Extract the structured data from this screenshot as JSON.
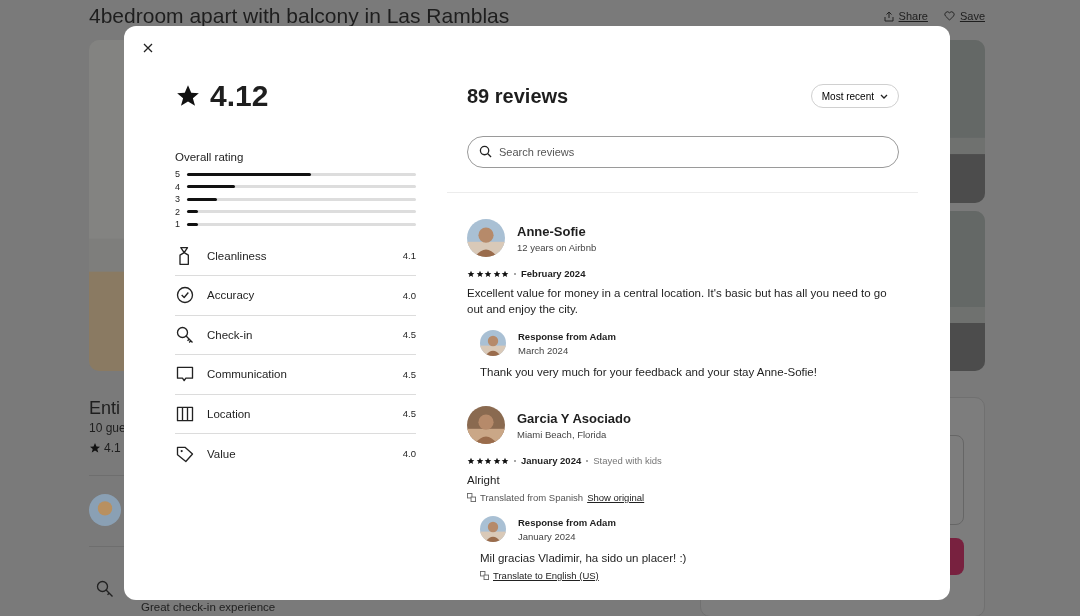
{
  "listing": {
    "title": "4bedroom apart with balcony in Las Ramblas",
    "actions": [
      {
        "label": "Share",
        "kind": "share"
      },
      {
        "label": "Save",
        "kind": "save"
      }
    ],
    "heading": "Enti",
    "subtitle": "10 gue",
    "rating": "4.1",
    "highlight": "Great check-in experience"
  },
  "modal": {
    "rating": "4.12",
    "overall_label": "Overall rating",
    "distribution": [
      {
        "label": "5",
        "level": 0.54
      },
      {
        "label": "4",
        "level": 0.21
      },
      {
        "label": "3",
        "level": 0.13
      },
      {
        "label": "2",
        "level": 0.05
      },
      {
        "label": "1",
        "level": 0.05
      }
    ],
    "categories": [
      {
        "label": "Cleanliness",
        "value": "4.1",
        "kind": "spray"
      },
      {
        "label": "Accuracy",
        "value": "4.0",
        "kind": "check"
      },
      {
        "label": "Check-in",
        "value": "4.5",
        "kind": "key"
      },
      {
        "label": "Communication",
        "value": "4.5",
        "kind": "chat"
      },
      {
        "label": "Location",
        "value": "4.5",
        "kind": "map"
      },
      {
        "label": "Value",
        "value": "4.0",
        "kind": "tag"
      }
    ],
    "count": "89 reviews",
    "sort": "Most recent",
    "search": {
      "placeholder": "Search reviews"
    },
    "reviews": [
      {
        "name": "Anne-Sofie",
        "meta": "12 years on Airbnb",
        "stars": 5,
        "date": "February 2024",
        "text": "Excellent value for money in a central location. It's basic but has all you need to go out and enjoy the city.",
        "response": {
          "title": "Response from Adam",
          "date": "March 2024",
          "text": "Thank you very much for your feedback and your stay Anne-Sofie!"
        }
      },
      {
        "name": "Garcia Y Asociado",
        "meta": "Miami Beach, Florida",
        "stars": 5,
        "date": "January 2024",
        "extra": "Stayed with kids",
        "text": "Alright",
        "translation": {
          "note": "Translated from Spanish",
          "link": "Show original"
        },
        "response": {
          "title": "Response from Adam",
          "date": "January 2024",
          "text": "Mil gracias Vladimir, ha sido un placer! :)",
          "link": "Translate to English (US)"
        }
      }
    ]
  }
}
